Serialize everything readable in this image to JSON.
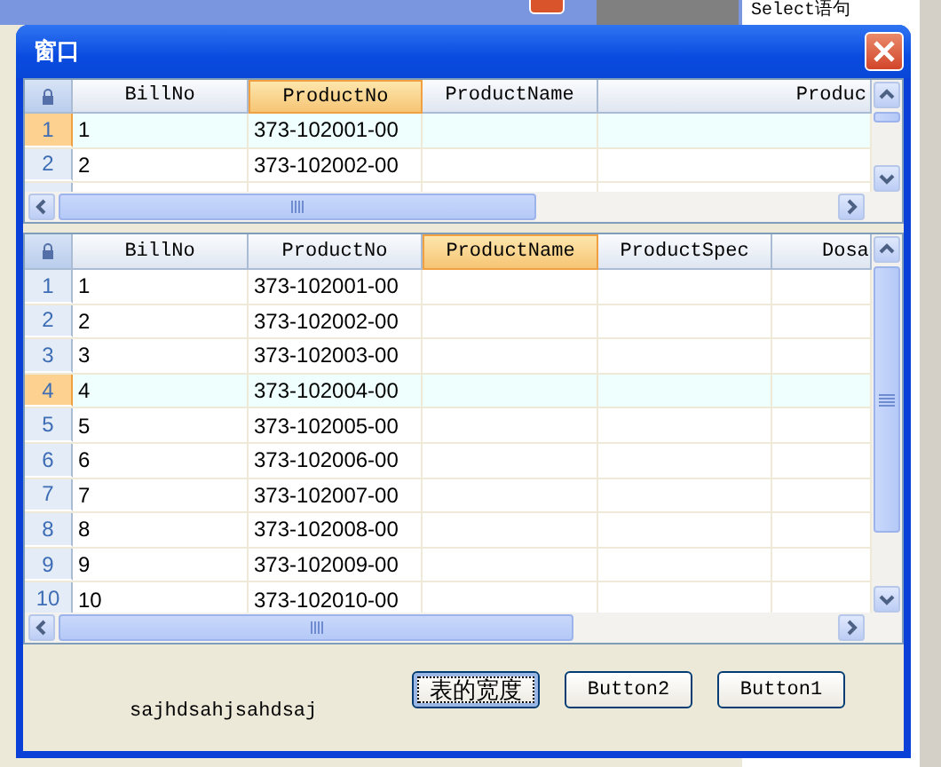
{
  "background": {
    "caption": "Select语句"
  },
  "window": {
    "title": "窗口"
  },
  "grids": [
    {
      "columns": [
        {
          "label": "BillNo",
          "selected": false
        },
        {
          "label": "ProductNo",
          "selected": true
        },
        {
          "label": "ProductName",
          "selected": false
        },
        {
          "label": "Produc",
          "selected": false
        }
      ],
      "rows": [
        {
          "number": "1",
          "selected": true,
          "cells": [
            "1",
            "373-102001-00"
          ]
        },
        {
          "number": "2",
          "selected": false,
          "cells": [
            "2",
            "373-102002-00"
          ]
        },
        {
          "number": "",
          "selected": false,
          "cells": []
        }
      ]
    },
    {
      "columns": [
        {
          "label": "BillNo",
          "selected": false
        },
        {
          "label": "ProductNo",
          "selected": false
        },
        {
          "label": "ProductName",
          "selected": true
        },
        {
          "label": "ProductSpec",
          "selected": false
        },
        {
          "label": "Dosa",
          "selected": false
        }
      ],
      "rows": [
        {
          "number": "1",
          "selected": false,
          "cells": [
            "1",
            "373-102001-00"
          ]
        },
        {
          "number": "2",
          "selected": false,
          "cells": [
            "2",
            "373-102002-00"
          ]
        },
        {
          "number": "3",
          "selected": false,
          "cells": [
            "3",
            "373-102003-00"
          ]
        },
        {
          "number": "4",
          "selected": true,
          "cells": [
            "4",
            "373-102004-00"
          ]
        },
        {
          "number": "5",
          "selected": false,
          "cells": [
            "5",
            "373-102005-00"
          ]
        },
        {
          "number": "6",
          "selected": false,
          "cells": [
            "6",
            "373-102006-00"
          ]
        },
        {
          "number": "7",
          "selected": false,
          "cells": [
            "7",
            "373-102007-00"
          ]
        },
        {
          "number": "8",
          "selected": false,
          "cells": [
            "8",
            "373-102008-00"
          ]
        },
        {
          "number": "9",
          "selected": false,
          "cells": [
            "9",
            "373-102009-00"
          ]
        },
        {
          "number": "10",
          "selected": false,
          "cells": [
            "10",
            "373-102010-00"
          ]
        }
      ]
    }
  ],
  "label": "sajhdsahjsahdsaj",
  "buttons": [
    {
      "label": "表的宽度",
      "focused": true
    },
    {
      "label": "Button2",
      "focused": false
    },
    {
      "label": "Button1",
      "focused": false
    }
  ]
}
